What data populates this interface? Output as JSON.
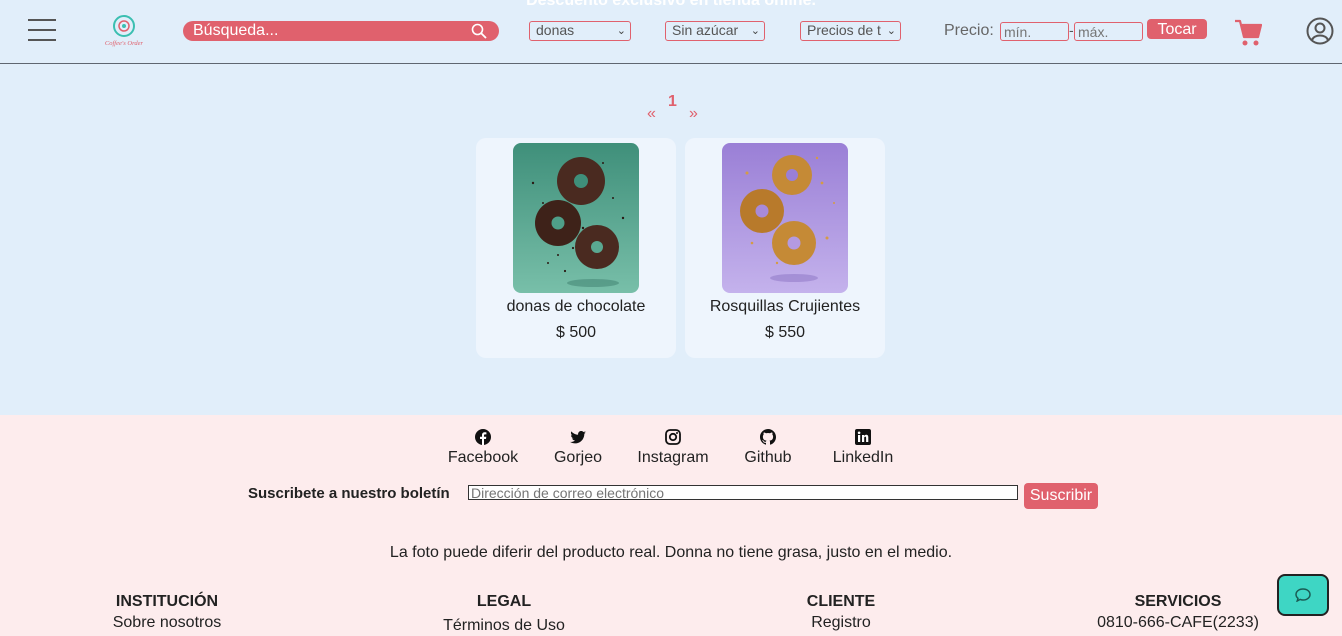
{
  "header": {
    "promo": "Descuento exclusivo en tienda online.",
    "logo_text": "Coffee's Order",
    "search": {
      "placeholder": "Búsqueda..."
    },
    "filters": [
      {
        "name": "category-select",
        "value": "donas"
      },
      {
        "name": "sugar-select",
        "value": "Sin azúcar"
      },
      {
        "name": "price-sort-select",
        "value": "Precios de t"
      }
    ],
    "price": {
      "label": "Precio:",
      "min_placeholder": "mín.",
      "max_placeholder": "máx.",
      "separator": "-"
    },
    "submit_label": "Tocar",
    "icons": {
      "menu": "hamburger-menu-icon",
      "cart": "cart-icon",
      "user": "user-account-icon",
      "search": "search-icon"
    }
  },
  "pagination": {
    "prev": "«",
    "current": "1",
    "next": "»"
  },
  "products": [
    {
      "name": "donas de chocolate",
      "price": "$ 500",
      "bg": "#4f9f88",
      "donut": "#4a2a20"
    },
    {
      "name": "Rosquillas Crujientes",
      "price": "$ 550",
      "bg": "#a88ad9",
      "donut": "#c58a36"
    }
  ],
  "footer": {
    "social": [
      {
        "label": "Facebook",
        "icon": "facebook-icon"
      },
      {
        "label": "Gorjeo",
        "icon": "twitter-icon"
      },
      {
        "label": "Instagram",
        "icon": "instagram-icon"
      },
      {
        "label": "Github",
        "icon": "github-icon"
      },
      {
        "label": "LinkedIn",
        "icon": "linkedin-icon"
      }
    ],
    "newsletter": {
      "label": "Suscribete a nuestro boletín",
      "placeholder": "Dirección de correo electrónico",
      "button": "Suscribir"
    },
    "disclaimer": "La foto puede diferir del producto real. Donna no tiene grasa, justo en el medio.",
    "columns": [
      {
        "title": "INSTITUCIÓN",
        "item": "Sobre nosotros"
      },
      {
        "title": "LEGAL",
        "item": "Términos de Uso"
      },
      {
        "title": "CLIENTE",
        "item": "Registro"
      },
      {
        "title": "SERVICIOS",
        "item": "0810-666-CAFE(2233)"
      }
    ]
  },
  "colors": {
    "accent": "#e0616d",
    "page_bg": "#e1eefa",
    "footer_bg": "#fdeced",
    "chat": "#3ed6c4"
  },
  "chat": {
    "icon": "chat-bubble-icon"
  }
}
